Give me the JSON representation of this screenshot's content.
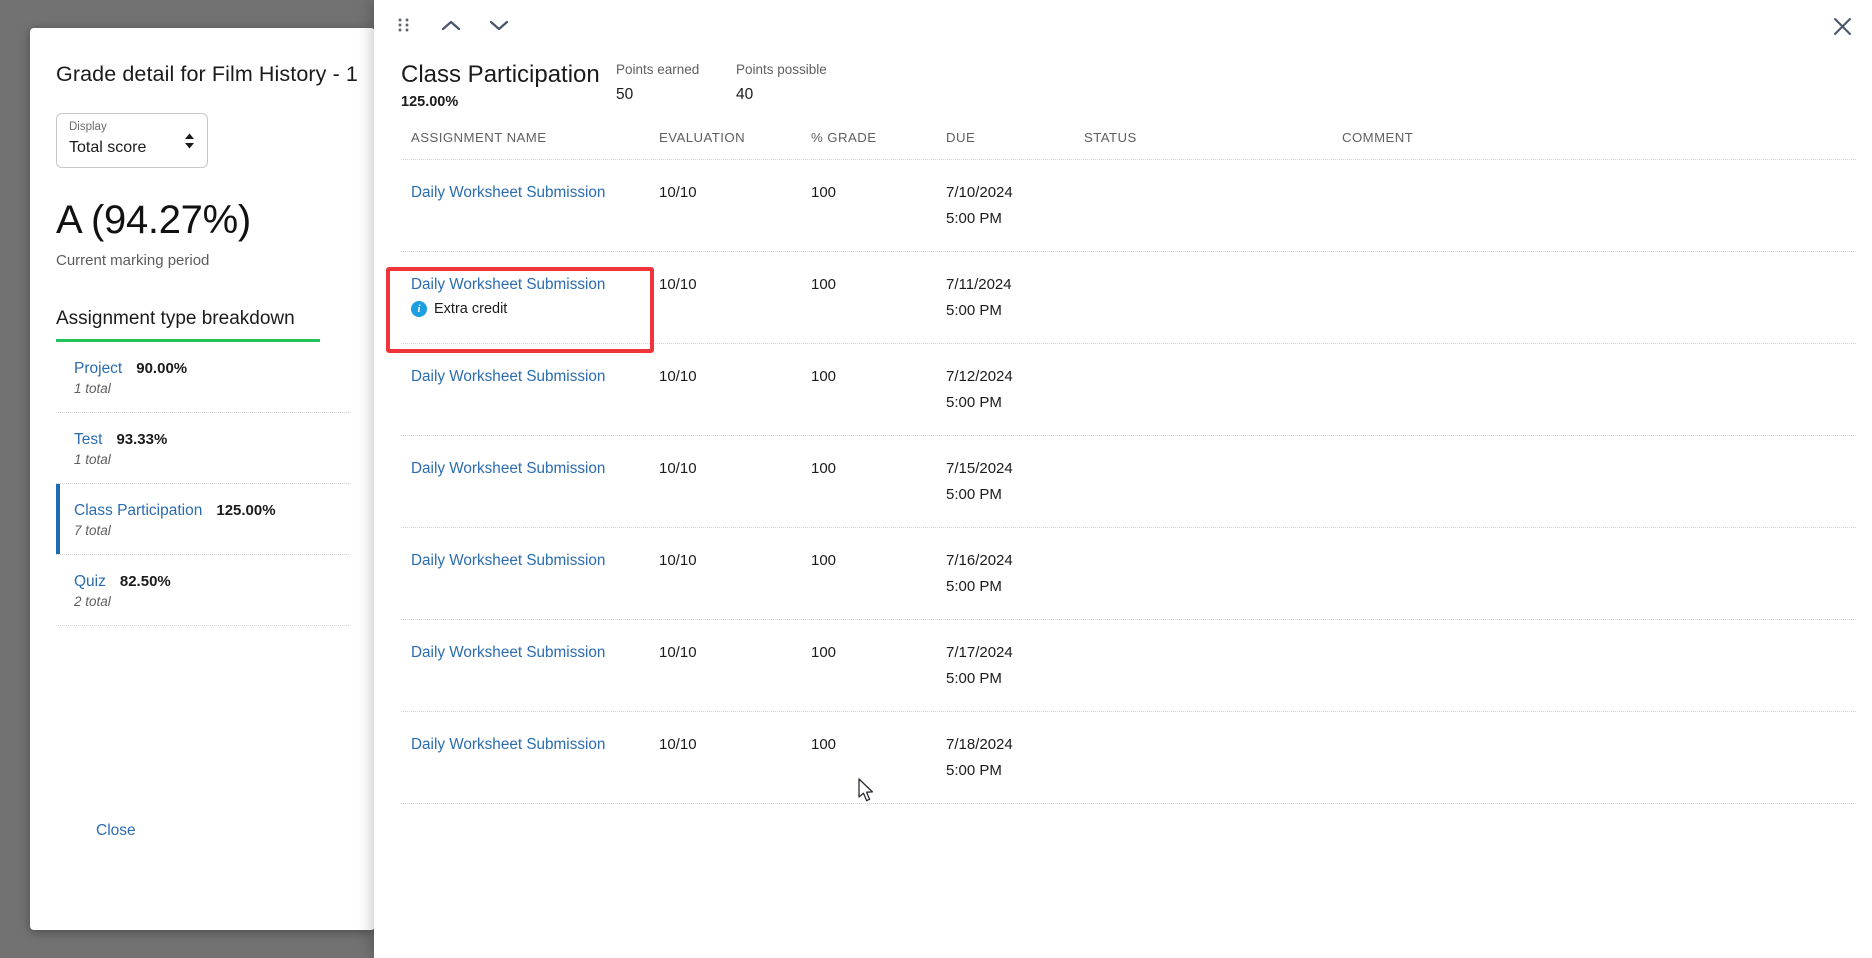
{
  "sidebar": {
    "title": "Grade detail for Film History - 1",
    "display_field": {
      "label": "Display",
      "value": "Total score",
      "options": [
        "Total score"
      ]
    },
    "grade": "A (94.27%)",
    "grade_caption": "Current marking period",
    "breakdown_heading": "Assignment type breakdown",
    "breakdown_items": [
      {
        "name": "Project",
        "percent": "90.00%",
        "total": "1 total",
        "active": false
      },
      {
        "name": "Test",
        "percent": "93.33%",
        "total": "1 total",
        "active": false
      },
      {
        "name": "Class Participation",
        "percent": "125.00%",
        "total": "7 total",
        "active": true
      },
      {
        "name": "Quiz",
        "percent": "82.50%",
        "total": "2 total",
        "active": false
      }
    ],
    "close_label": "Close"
  },
  "panel": {
    "toolbar": {
      "drag_handle": "drag-handle-icon",
      "previous": "chevron-up-icon",
      "next": "chevron-down-icon",
      "close": "close-icon"
    },
    "summary": {
      "title": "Class Participation",
      "percent": "125.00%",
      "points_earned_label": "Points earned",
      "points_earned_value": "50",
      "points_possible_label": "Points possible",
      "points_possible_value": "40"
    },
    "table": {
      "columns": [
        "ASSIGNMENT NAME",
        "EVALUATION",
        "% GRADE",
        "DUE",
        "STATUS",
        "COMMENT"
      ],
      "rows": [
        {
          "name": "Daily Worksheet Submission",
          "evaluation": "10/10",
          "grade": "100",
          "due_date": "7/10/2024",
          "due_time": "5:00 PM",
          "status": "",
          "comment": "",
          "badge": ""
        },
        {
          "name": "Daily Worksheet Submission",
          "evaluation": "10/10",
          "grade": "100",
          "due_date": "7/11/2024",
          "due_time": "5:00 PM",
          "status": "",
          "comment": "",
          "badge": "Extra credit"
        },
        {
          "name": "Daily Worksheet Submission",
          "evaluation": "10/10",
          "grade": "100",
          "due_date": "7/12/2024",
          "due_time": "5:00 PM",
          "status": "",
          "comment": "",
          "badge": ""
        },
        {
          "name": "Daily Worksheet Submission",
          "evaluation": "10/10",
          "grade": "100",
          "due_date": "7/15/2024",
          "due_time": "5:00 PM",
          "status": "",
          "comment": "",
          "badge": ""
        },
        {
          "name": "Daily Worksheet Submission",
          "evaluation": "10/10",
          "grade": "100",
          "due_date": "7/16/2024",
          "due_time": "5:00 PM",
          "status": "",
          "comment": "",
          "badge": ""
        },
        {
          "name": "Daily Worksheet Submission",
          "evaluation": "10/10",
          "grade": "100",
          "due_date": "7/17/2024",
          "due_time": "5:00 PM",
          "status": "",
          "comment": "",
          "badge": ""
        },
        {
          "name": "Daily Worksheet Submission",
          "evaluation": "10/10",
          "grade": "100",
          "due_date": "7/18/2024",
          "due_time": "5:00 PM",
          "status": "",
          "comment": "",
          "badge": ""
        }
      ]
    }
  },
  "colors": {
    "link": "#2b6cb0",
    "accent_green": "#21c45d",
    "active_bar": "#1b6cb3",
    "info_badge": "#1b9fe0",
    "highlight": "#f0353a",
    "backdrop": "#727272"
  }
}
